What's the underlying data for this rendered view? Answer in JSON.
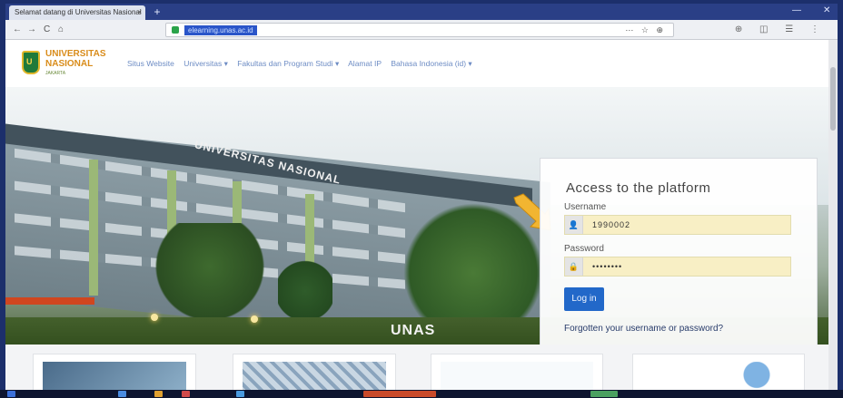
{
  "browser": {
    "tab_title": "Selamat datang di Universitas Nasional",
    "tab_close": "×",
    "new_tab": "+",
    "url": "elearning.unas.ac.id",
    "url_actions": "⋯ ☆ ⊕",
    "toolbar_icons": "⊕ ◫ ☰ ⋮",
    "win_min": "—",
    "win_close": "✕",
    "nav": {
      "back": "←",
      "forward": "→",
      "reload": "C",
      "home": "⌂"
    }
  },
  "site": {
    "logo_line1": "UNIVERSITAS",
    "logo_line2": "NASIONAL",
    "logo_sub": "JAKARTA",
    "menu": [
      "Situs Website",
      "Universitas ▾",
      "Fakultas dan Program Studi ▾",
      "Alamat IP",
      "Bahasa Indonesia (id) ▾"
    ]
  },
  "hero": {
    "roof_text": "UNIVERSITAS NASIONAL",
    "building_text": "UNAS"
  },
  "login": {
    "title": "Access to the platform",
    "username_label": "Username",
    "username_value": "1990002",
    "password_label": "Password",
    "password_value": "••••••••",
    "button": "Log in",
    "forgot": "Forgotten your username or password?",
    "user_icon": "👤",
    "lock_icon": "🔒"
  },
  "colors": {
    "accent": "#2268c9",
    "arrow": "#f2b531",
    "field_bg": "#f8efc5"
  }
}
